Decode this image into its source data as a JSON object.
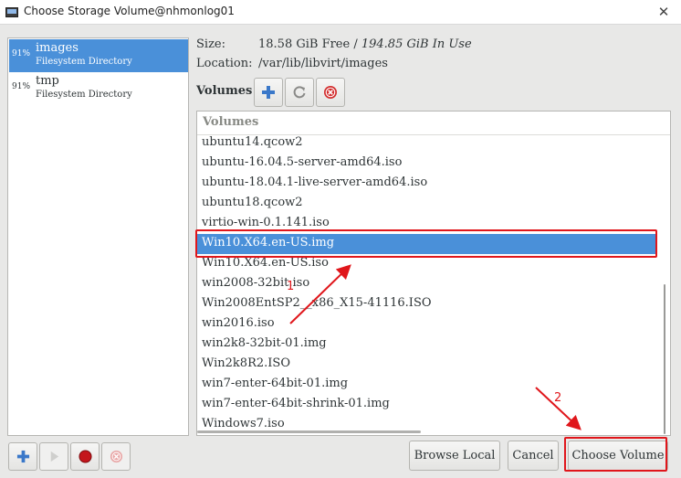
{
  "window": {
    "title": "Choose Storage Volume@nhmonlog01",
    "close_glyph": "✕"
  },
  "pools": [
    {
      "pct": "91%",
      "name": "images",
      "type": "Filesystem Directory",
      "selected": true
    },
    {
      "pct": "91%",
      "name": "tmp",
      "type": "Filesystem Directory",
      "selected": false
    }
  ],
  "info": {
    "size_label": "Size:",
    "size_free": "18.58 GiB Free",
    "size_sep": " / ",
    "size_inuse": "194.85 GiB In Use",
    "location_label": "Location:",
    "location_value": "/var/lib/libvirt/images"
  },
  "volumes": {
    "section_label": "Volumes",
    "column_header": "Volumes",
    "rows": [
      "ubuntu14.qcow2",
      "ubuntu-16.04.5-server-amd64.iso",
      "ubuntu-18.04.1-live-server-amd64.iso",
      "ubuntu18.qcow2",
      "virtio-win-0.1.141.iso",
      "Win10.X64.en-US.img",
      "Win10.X64.en-US.iso",
      "win2008-32bit.iso",
      "Win2008EntSP2__x86_X15-41116.ISO",
      "win2016.iso",
      "win2k8-32bit-01.img",
      "Win2k8R2.ISO",
      "win7-enter-64bit-01.img",
      "win7-enter-64bit-shrink-01.img",
      "Windows7.iso"
    ],
    "selected_index": 5
  },
  "buttons": {
    "browse_local": "Browse Local",
    "cancel": "Cancel",
    "choose_volume": "Choose Volume"
  },
  "annotations": {
    "step1": "1",
    "step2": "2"
  },
  "colors": {
    "selection": "#4a90d9",
    "annotation": "#e0161b"
  },
  "icons": {
    "add_volume": "plus-icon",
    "refresh_volumes": "refresh-icon",
    "delete_volume": "delete-icon",
    "add_pool": "plus-icon",
    "start_pool": "play-icon",
    "stop_pool": "stop-icon",
    "delete_pool": "delete-icon"
  }
}
